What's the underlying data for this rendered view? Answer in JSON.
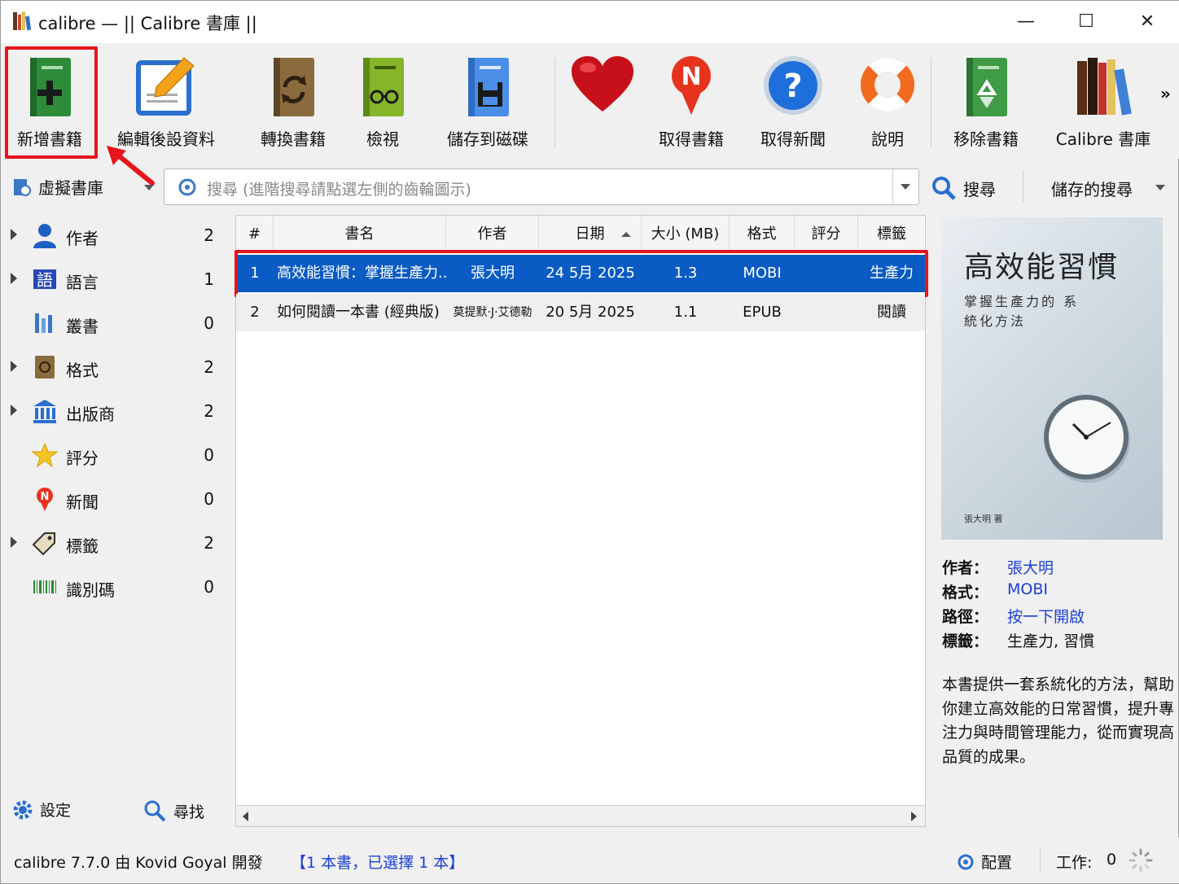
{
  "window": {
    "title": "calibre — || Calibre 書庫 ||",
    "minimize": "—",
    "maximize": "☐",
    "close": "✕"
  },
  "toolbar": {
    "add": "新增書籍",
    "edit": "編輯後設資料",
    "convert": "轉換書籍",
    "view": "檢視",
    "save": "儲存到磁碟",
    "get_books": "取得書籍",
    "news": "取得新聞",
    "help": "說明",
    "remove": "移除書籍",
    "library": "Calibre 書庫",
    "more": "»"
  },
  "search": {
    "virtual_library": "虛擬書庫",
    "placeholder": "搜尋 (進階搜尋請點選左側的齒輪圖示)",
    "button": "搜尋",
    "saved": "儲存的搜尋"
  },
  "sidebar": {
    "items": [
      {
        "label": "作者",
        "count": "2"
      },
      {
        "label": "語言",
        "count": "1"
      },
      {
        "label": "叢書",
        "count": "0"
      },
      {
        "label": "格式",
        "count": "2"
      },
      {
        "label": "出版商",
        "count": "2"
      },
      {
        "label": "評分",
        "count": "0"
      },
      {
        "label": "新聞",
        "count": "0"
      },
      {
        "label": "標籤",
        "count": "2"
      },
      {
        "label": "識別碼",
        "count": "0"
      }
    ],
    "settings": "設定",
    "find": "尋找"
  },
  "table": {
    "headers": [
      "#",
      "書名",
      "作者",
      "日期",
      "大小 (MB)",
      "格式",
      "評分",
      "標籤"
    ],
    "rows": [
      {
        "num": "1",
        "title": "高效能習慣：掌握生產力...",
        "author": "張大明",
        "date": "24 5月 2025",
        "size": "1.3",
        "format": "MOBI",
        "rating": "",
        "tags": "生產力"
      },
      {
        "num": "2",
        "title": "如何閱讀一本書 (經典版)",
        "author": "莫提默·J·艾德勒",
        "date": "20 5月 2025",
        "size": "1.1",
        "format": "EPUB",
        "rating": "",
        "tags": "閱讀"
      }
    ]
  },
  "details": {
    "cover_title": "高效能習慣",
    "cover_subtitle": "掌握生產力的 系統化方法",
    "cover_author": "張大明 著",
    "author_label": "作者：",
    "author": "張大明",
    "format_label": "格式：",
    "format": "MOBI",
    "path_label": "路徑：",
    "path": "按一下開啟",
    "tags_label": "標籤：",
    "tags": "生產力, 習慣",
    "description": "本書提供一套系統化的方法，幫助你建立高效能的日常習慣，提升專注力與時間管理能力，從而實現高品質的成果。"
  },
  "status": {
    "version": "calibre 7.7.0 由 Kovid Goyal 開發",
    "selection": "【1 本書，已選擇 1 本】",
    "layout": "配置",
    "jobs_label": "工作:",
    "jobs": "0"
  },
  "colors": {
    "selection": "#0a5bc4",
    "highlight": "#e8141b",
    "link": "#1b3fd6"
  }
}
